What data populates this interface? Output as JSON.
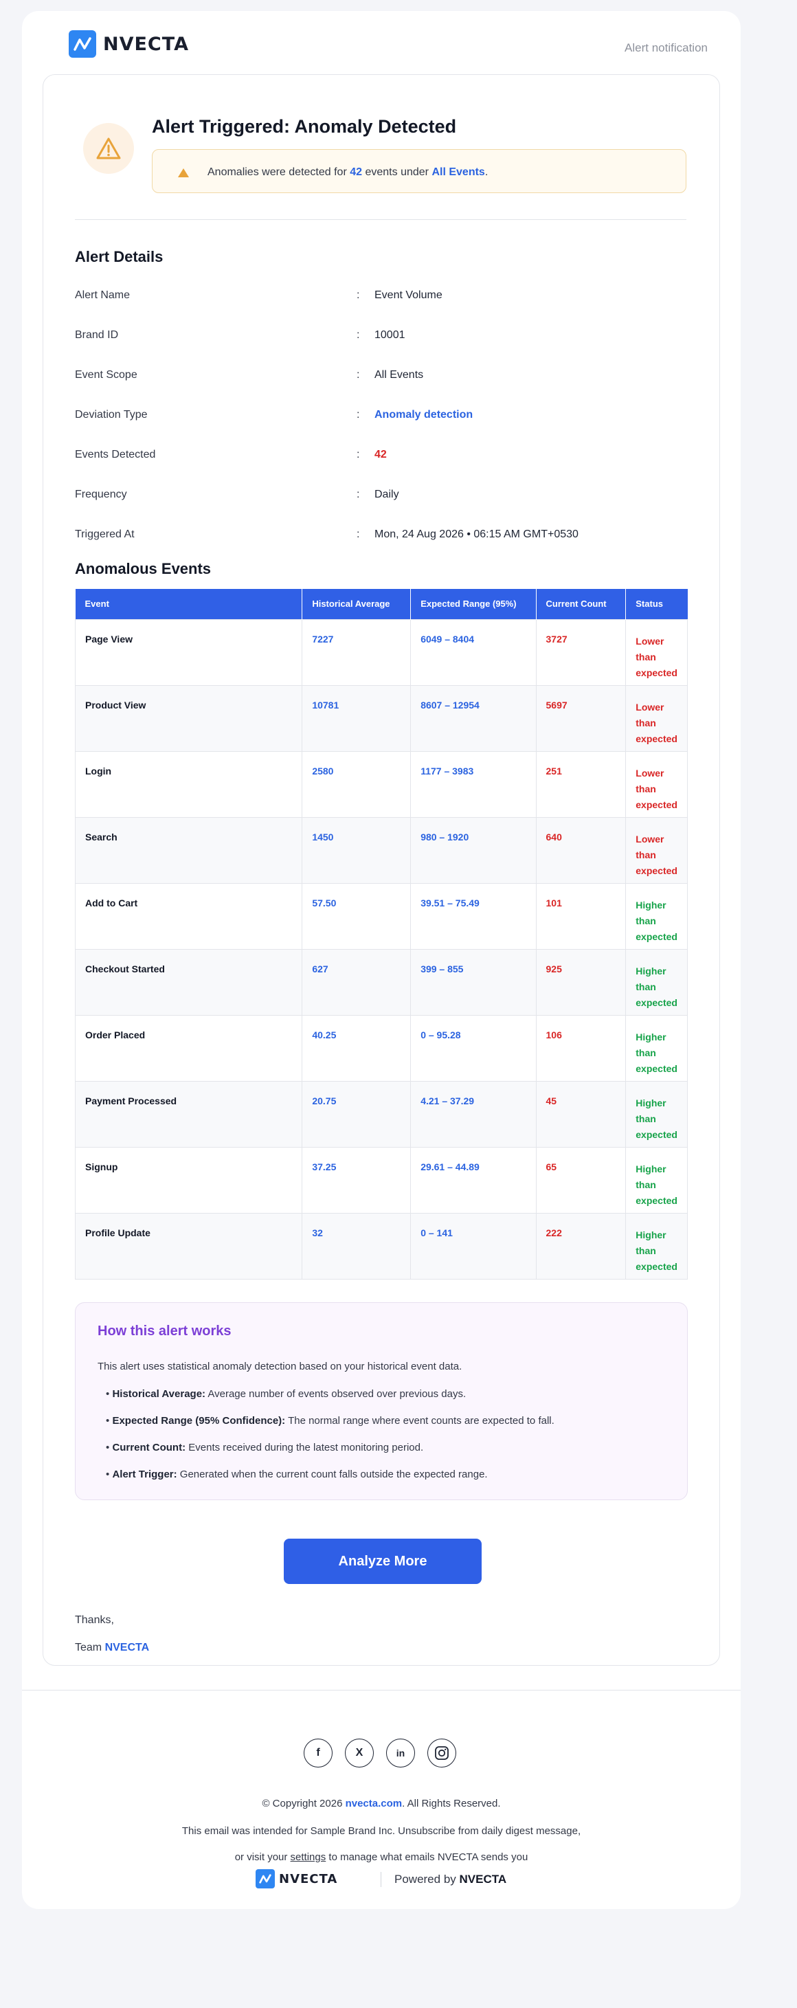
{
  "header": {
    "logo_text": "NVECTA",
    "note": "Alert notification"
  },
  "alert": {
    "title": "Alert Triggered: Anomaly Detected",
    "banner_prefix": "Anomalies were detected for",
    "banner_count": "42",
    "banner_middle": "events under",
    "banner_scope": "All Events",
    "banner_suffix": ".",
    "icon": "warning-triangle-icon"
  },
  "details": {
    "title": "Alert Details",
    "colon": ":",
    "rows": [
      {
        "label": "Alert Name",
        "value": "Event Volume"
      },
      {
        "label": "Brand ID",
        "value": "10001"
      },
      {
        "label": "Event Scope",
        "value": "All Events"
      },
      {
        "label": "Deviation Type",
        "value": "Anomaly detection"
      },
      {
        "label": "Events Detected",
        "value": "42"
      },
      {
        "label": "Frequency",
        "value": "Daily"
      },
      {
        "label": "Triggered At",
        "value": "Mon, 24 Aug 2026 • 06:15 AM GMT+0530"
      }
    ]
  },
  "anomalies": {
    "title": "Anomalous Events",
    "columns": [
      "Event",
      "Historical Average",
      "Expected Range (95%)",
      "Current Count",
      "Status"
    ],
    "rows": [
      {
        "event": "Page View",
        "avg": "7227",
        "range": "6049 – 8404",
        "count": "3727",
        "status": "Lower than expected"
      },
      {
        "event": "Product View",
        "avg": "10781",
        "range": "8607 – 12954",
        "count": "5697",
        "status": "Lower than expected"
      },
      {
        "event": "Login",
        "avg": "2580",
        "range": "1177 – 3983",
        "count": "251",
        "status": "Lower than expected"
      },
      {
        "event": "Search",
        "avg": "1450",
        "range": "980 – 1920",
        "count": "640",
        "status": "Lower than expected"
      },
      {
        "event": "Add to Cart",
        "avg": "57.50",
        "range": "39.51 – 75.49",
        "count": "101",
        "status": "Higher than expected"
      },
      {
        "event": "Checkout Started",
        "avg": "627",
        "range": "399 – 855",
        "count": "925",
        "status": "Higher than expected"
      },
      {
        "event": "Order Placed",
        "avg": "40.25",
        "range": "0 – 95.28",
        "count": "106",
        "status": "Higher than expected"
      },
      {
        "event": "Payment Processed",
        "avg": "20.75",
        "range": "4.21 – 37.29",
        "count": "45",
        "status": "Higher than expected"
      },
      {
        "event": "Signup",
        "avg": "37.25",
        "range": "29.61 – 44.89",
        "count": "65",
        "status": "Higher than expected"
      },
      {
        "event": "Profile Update",
        "avg": "32",
        "range": "0 – 141",
        "count": "222",
        "status": "Higher than expected"
      }
    ]
  },
  "how": {
    "title": "How this alert works",
    "intro": "This alert uses statistical anomaly detection based on your historical event data.",
    "items": [
      {
        "term": "Historical Average:",
        "desc": "Average number of events observed over previous days."
      },
      {
        "term": "Expected Range (95% Confidence):",
        "desc": "The normal range where event counts are expected to fall."
      },
      {
        "term": "Current Count:",
        "desc": "Events received during the latest monitoring period."
      },
      {
        "term": "Alert Trigger:",
        "desc": "Generated when the current count falls outside the expected range."
      }
    ]
  },
  "cta": {
    "label": "Analyze More"
  },
  "signoff": {
    "thanks": "Thanks,",
    "team_prefix": "Team",
    "team_name": "NVECTA"
  },
  "footer": {
    "socials": [
      {
        "icon": "facebook-icon",
        "glyph": "f"
      },
      {
        "icon": "x-icon",
        "glyph": "X"
      },
      {
        "icon": "linkedin-icon",
        "glyph": "in"
      },
      {
        "icon": "instagram-icon",
        "glyph": ""
      }
    ],
    "copyright_prefix": "© Copyright 2026",
    "copyright_link": "nvecta.com",
    "copyright_suffix": ". All Rights Reserved.",
    "intended": "This email was intended for Sample Brand Inc. Unsubscribe from daily digest message,",
    "manage_prefix": "or visit your",
    "manage_link": "settings",
    "manage_suffix": "to manage what emails NVECTA sends you",
    "logo_text": "NVECTA",
    "powered_prefix": "Powered by",
    "powered_brand": "NVECTA"
  },
  "colors": {
    "primary": "#2f5fe6",
    "alert_red": "#d92626",
    "success_green": "#17a34a",
    "accent_purple": "#7c3fd6",
    "warning_amber": "#e8a33a"
  }
}
